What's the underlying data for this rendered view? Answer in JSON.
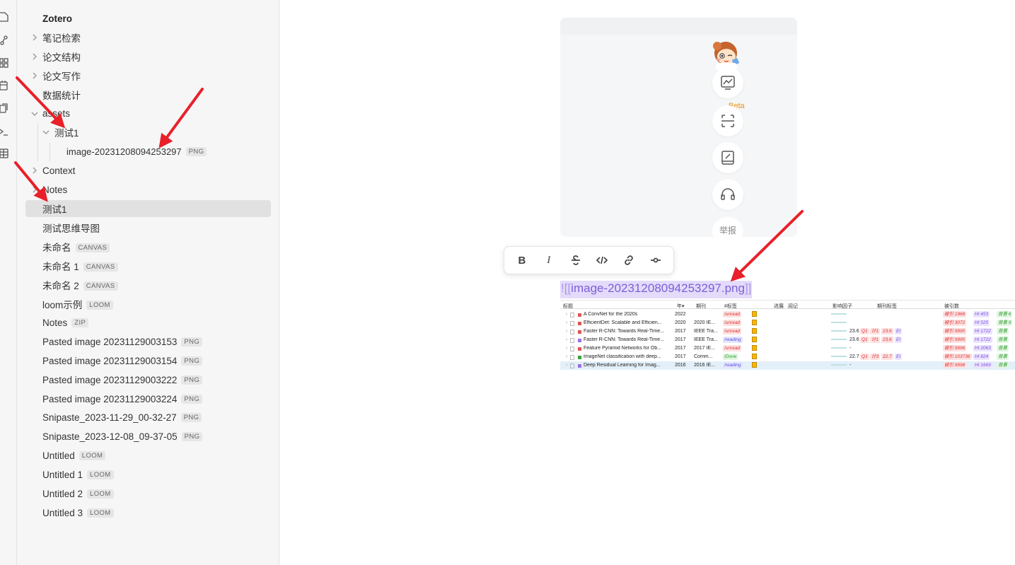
{
  "ribbon": {
    "icons": [
      "file-icon",
      "graph-icon",
      "blocks-icon",
      "calendar-icon",
      "copy-icon",
      "terminal-icon",
      "table-icon"
    ]
  },
  "sidebar": {
    "items": [
      {
        "label": "Zotero",
        "badge": "",
        "level": 0,
        "chevron": "none",
        "bold": true
      },
      {
        "label": "笔记检索",
        "badge": "",
        "level": 0,
        "chevron": "right"
      },
      {
        "label": "论文结构",
        "badge": "",
        "level": 0,
        "chevron": "right"
      },
      {
        "label": "论文写作",
        "badge": "",
        "level": 0,
        "chevron": "right"
      },
      {
        "label": "数据统计",
        "badge": "",
        "level": 0,
        "chevron": "none"
      },
      {
        "label": "assets",
        "badge": "",
        "level": 0,
        "chevron": "down"
      },
      {
        "label": "测试1",
        "badge": "",
        "level": 1,
        "chevron": "down"
      },
      {
        "label": "image-20231208094253297",
        "badge": "PNG",
        "level": 2,
        "chevron": "none"
      },
      {
        "label": "Context",
        "badge": "",
        "level": 0,
        "chevron": "right"
      },
      {
        "label": "Notes",
        "badge": "",
        "level": 0,
        "chevron": "right"
      },
      {
        "label": "测试1",
        "badge": "",
        "level": 0,
        "chevron": "none",
        "active": true
      },
      {
        "label": "测试思维导图",
        "badge": "",
        "level": 0,
        "chevron": "none"
      },
      {
        "label": "未命名",
        "badge": "CANVAS",
        "level": 0,
        "chevron": "none"
      },
      {
        "label": "未命名 1",
        "badge": "CANVAS",
        "level": 0,
        "chevron": "none"
      },
      {
        "label": "未命名 2",
        "badge": "CANVAS",
        "level": 0,
        "chevron": "none"
      },
      {
        "label": "loom示例",
        "badge": "LOOM",
        "level": 0,
        "chevron": "none"
      },
      {
        "label": "Notes",
        "badge": "ZIP",
        "level": 0,
        "chevron": "none"
      },
      {
        "label": "Pasted image 20231129003153",
        "badge": "PNG",
        "level": 0,
        "chevron": "none"
      },
      {
        "label": "Pasted image 20231129003154",
        "badge": "PNG",
        "level": 0,
        "chevron": "none"
      },
      {
        "label": "Pasted image 20231129003222",
        "badge": "PNG",
        "level": 0,
        "chevron": "none"
      },
      {
        "label": "Pasted image 20231129003224",
        "badge": "PNG",
        "level": 0,
        "chevron": "none"
      },
      {
        "label": "Snipaste_2023-11-29_00-32-27",
        "badge": "PNG",
        "level": 0,
        "chevron": "none"
      },
      {
        "label": "Snipaste_2023-12-08_09-37-05",
        "badge": "PNG",
        "level": 0,
        "chevron": "none"
      },
      {
        "label": "Untitled",
        "badge": "LOOM",
        "level": 0,
        "chevron": "none"
      },
      {
        "label": "Untitled 1",
        "badge": "LOOM",
        "level": 0,
        "chevron": "none"
      },
      {
        "label": "Untitled 2",
        "badge": "LOOM",
        "level": 0,
        "chevron": "none"
      },
      {
        "label": "Untitled 3",
        "badge": "LOOM",
        "level": 0,
        "chevron": "none"
      }
    ]
  },
  "embed_card": {
    "beta_label": "Beta",
    "report_label": "举报",
    "buttons": [
      "trend-chart-icon",
      "scan-icon",
      "notebook-icon",
      "headset-icon"
    ]
  },
  "format_toolbar": {
    "bold": "B",
    "italic": "I",
    "buttons": [
      "bold-button",
      "italic-button",
      "strikethrough-button",
      "code-button",
      "link-button",
      "commit-button"
    ]
  },
  "editor": {
    "link_open": "![[",
    "link_text": "image-20231208094253297.png",
    "link_close": "]]"
  },
  "zotero_table": {
    "headers": [
      "标题",
      "年▾",
      "期刊",
      "#标签",
      "进展",
      "阅记",
      "影响因子",
      "期刊标签",
      "被引数"
    ],
    "rows": [
      {
        "title": "A ConvNet for the 2020s",
        "color": "#e05555",
        "year": "2022",
        "journal": "",
        "tag": "/unread",
        "tag_class": "t-red",
        "if": "",
        "qtags": [],
        "cites": "被引 1968",
        "hi": "HI 453",
        "extra": "背景 6"
      },
      {
        "title": "EfficientDet: Scalable and Efficien...",
        "color": "#e05555",
        "year": "2020",
        "journal": "2020 IE...",
        "tag": "/unread",
        "tag_class": "t-red",
        "if": "",
        "qtags": [],
        "cites": "被引 3072",
        "hi": "HI 525",
        "extra": "背景 9"
      },
      {
        "title": "Faster R-CNN: Towards Real-Time...",
        "color": "#e05555",
        "year": "2017",
        "journal": "IEEE Tra...",
        "tag": "/unread",
        "tag_class": "t-red",
        "if": "23.6",
        "qtags": [
          "Q1",
          "计1",
          "23.6",
          "EI"
        ],
        "cites": "被引 9995",
        "hi": "HI 1722",
        "extra": "背景"
      },
      {
        "title": "Faster R-CNN: Towards Real-Time...",
        "color": "#9b6fe0",
        "year": "2017",
        "journal": "IEEE Tra...",
        "tag": "/reading",
        "tag_class": "t-blue",
        "if": "23.6",
        "qtags": [
          "Q1",
          "计1",
          "23.6",
          "EI"
        ],
        "cites": "被引 9995",
        "hi": "HI 1722",
        "extra": "背景"
      },
      {
        "title": "Feature Pyramid Networks for Ob...",
        "color": "#e05555",
        "year": "2017",
        "journal": "2017 IE...",
        "tag": "/unread",
        "tag_class": "t-red",
        "if": "-",
        "qtags": [],
        "cites": "被引 9996",
        "hi": "HI 2063",
        "extra": "背景"
      },
      {
        "title": "ImageNet classification with deep...",
        "color": "#3aa33a",
        "year": "2017",
        "journal": "Comm...",
        "tag": "/Done",
        "tag_class": "t-green",
        "if": "22.7",
        "qtags": [
          "Q1",
          "计3",
          "22.7",
          "EI"
        ],
        "cites": "被引 103736",
        "hi": "HI 824",
        "extra": "背景"
      },
      {
        "title": "Deep Residual Learning for Imag...",
        "color": "#9b6fe0",
        "year": "2016",
        "journal": "2016 IE...",
        "tag": "/reading",
        "tag_class": "t-blue",
        "if": "-",
        "qtags": [],
        "cites": "被引 9998",
        "hi": "HI 1669",
        "extra": "背景"
      }
    ]
  }
}
